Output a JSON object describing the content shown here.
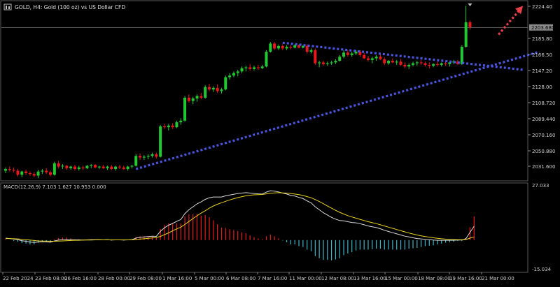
{
  "header": {
    "title": "GOLD, H4:  Gold (100 oz) vs US Dollar CFD",
    "icon": "chart-window-icon"
  },
  "colors": {
    "background": "#000000",
    "up": "#22c832",
    "down": "#e8191e",
    "grid": "#3c3c3c",
    "axis_text": "#d0d0d0",
    "trendline": "#4a55e0",
    "arrow": "#e8404a",
    "macd_pos": "#e8191e",
    "macd_neg": "#3fb6c6",
    "macd_line": "#d8d8d8",
    "signal_line": "#e6d21e",
    "price_line": "#8a8a8a"
  },
  "price_axis": {
    "labels": [
      "2224.40",
      "2185.80",
      "2166.50",
      "2147.20",
      "2128.00",
      "2108.720",
      "2089.440",
      "2070.160",
      "2050.880",
      "2031.600"
    ]
  },
  "current_price": "2203.680",
  "macd": {
    "label": "MACD(12,26,9) 7.103 1.627 10.953 0.000",
    "max_label": "27.033",
    "min_label": "-15.034"
  },
  "time_axis": {
    "labels": [
      "22 Feb 2024",
      "23 Feb 08:00",
      "26 Feb 16:00",
      "28 Feb 00:00",
      "29 Feb 08:00",
      "1 Mar 16:00",
      "5 Mar 00:00",
      "6 Mar 08:00",
      "7 Mar 16:00",
      "11 Mar 00:00",
      "12 Mar 08:00",
      "13 Mar 16:00",
      "15 Mar 00:00",
      "18 Mar 08:00",
      "19 Mar 16:00",
      "21 Mar 00:00"
    ]
  },
  "chart_data": {
    "type": "candlestick",
    "title": "GOLD, H4:  Gold (100 oz) vs US Dollar CFD",
    "ylim": [
      2020,
      2232
    ],
    "candles": [
      {
        "o": 2029,
        "h": 2033,
        "l": 2026,
        "c": 2031
      },
      {
        "o": 2031,
        "h": 2034,
        "l": 2028,
        "c": 2030
      },
      {
        "o": 2030,
        "h": 2033,
        "l": 2027,
        "c": 2029
      },
      {
        "o": 2029,
        "h": 2031,
        "l": 2022,
        "c": 2024
      },
      {
        "o": 2024,
        "h": 2029,
        "l": 2021,
        "c": 2028
      },
      {
        "o": 2028,
        "h": 2030,
        "l": 2024,
        "c": 2026
      },
      {
        "o": 2026,
        "h": 2028,
        "l": 2023,
        "c": 2025
      },
      {
        "o": 2025,
        "h": 2027,
        "l": 2021,
        "c": 2023
      },
      {
        "o": 2023,
        "h": 2030,
        "l": 2020,
        "c": 2028
      },
      {
        "o": 2028,
        "h": 2031,
        "l": 2025,
        "c": 2029
      },
      {
        "o": 2029,
        "h": 2032,
        "l": 2025,
        "c": 2027
      },
      {
        "o": 2027,
        "h": 2029,
        "l": 2022,
        "c": 2024
      },
      {
        "o": 2024,
        "h": 2040,
        "l": 2023,
        "c": 2038
      },
      {
        "o": 2038,
        "h": 2041,
        "l": 2032,
        "c": 2034
      },
      {
        "o": 2034,
        "h": 2037,
        "l": 2031,
        "c": 2035
      },
      {
        "o": 2035,
        "h": 2036,
        "l": 2030,
        "c": 2032
      },
      {
        "o": 2032,
        "h": 2035,
        "l": 2030,
        "c": 2034
      },
      {
        "o": 2034,
        "h": 2036,
        "l": 2029,
        "c": 2031
      },
      {
        "o": 2031,
        "h": 2035,
        "l": 2029,
        "c": 2033
      },
      {
        "o": 2033,
        "h": 2035,
        "l": 2030,
        "c": 2032
      },
      {
        "o": 2032,
        "h": 2036,
        "l": 2031,
        "c": 2035
      },
      {
        "o": 2035,
        "h": 2037,
        "l": 2032,
        "c": 2036
      },
      {
        "o": 2036,
        "h": 2037,
        "l": 2032,
        "c": 2033
      },
      {
        "o": 2033,
        "h": 2035,
        "l": 2031,
        "c": 2034
      },
      {
        "o": 2034,
        "h": 2036,
        "l": 2031,
        "c": 2032
      },
      {
        "o": 2032,
        "h": 2035,
        "l": 2030,
        "c": 2034
      },
      {
        "o": 2034,
        "h": 2036,
        "l": 2030,
        "c": 2031
      },
      {
        "o": 2031,
        "h": 2035,
        "l": 2029,
        "c": 2034
      },
      {
        "o": 2034,
        "h": 2036,
        "l": 2031,
        "c": 2033
      },
      {
        "o": 2033,
        "h": 2035,
        "l": 2030,
        "c": 2031
      },
      {
        "o": 2031,
        "h": 2035,
        "l": 2029,
        "c": 2034
      },
      {
        "o": 2034,
        "h": 2036,
        "l": 2032,
        "c": 2035
      },
      {
        "o": 2035,
        "h": 2049,
        "l": 2034,
        "c": 2047
      },
      {
        "o": 2047,
        "h": 2050,
        "l": 2042,
        "c": 2045
      },
      {
        "o": 2045,
        "h": 2048,
        "l": 2042,
        "c": 2046
      },
      {
        "o": 2046,
        "h": 2049,
        "l": 2043,
        "c": 2047
      },
      {
        "o": 2047,
        "h": 2051,
        "l": 2045,
        "c": 2049
      },
      {
        "o": 2049,
        "h": 2051,
        "l": 2044,
        "c": 2046
      },
      {
        "o": 2046,
        "h": 2085,
        "l": 2045,
        "c": 2083
      },
      {
        "o": 2083,
        "h": 2086,
        "l": 2080,
        "c": 2082
      },
      {
        "o": 2082,
        "h": 2086,
        "l": 2078,
        "c": 2084
      },
      {
        "o": 2084,
        "h": 2087,
        "l": 2080,
        "c": 2082
      },
      {
        "o": 2082,
        "h": 2090,
        "l": 2081,
        "c": 2088
      },
      {
        "o": 2088,
        "h": 2093,
        "l": 2085,
        "c": 2090
      },
      {
        "o": 2090,
        "h": 2120,
        "l": 2089,
        "c": 2118
      },
      {
        "o": 2118,
        "h": 2122,
        "l": 2112,
        "c": 2114
      },
      {
        "o": 2114,
        "h": 2119,
        "l": 2110,
        "c": 2117
      },
      {
        "o": 2117,
        "h": 2122,
        "l": 2113,
        "c": 2120
      },
      {
        "o": 2120,
        "h": 2124,
        "l": 2116,
        "c": 2118
      },
      {
        "o": 2118,
        "h": 2133,
        "l": 2117,
        "c": 2131
      },
      {
        "o": 2131,
        "h": 2135,
        "l": 2126,
        "c": 2128
      },
      {
        "o": 2128,
        "h": 2132,
        "l": 2125,
        "c": 2130
      },
      {
        "o": 2130,
        "h": 2134,
        "l": 2124,
        "c": 2126
      },
      {
        "o": 2126,
        "h": 2130,
        "l": 2123,
        "c": 2128
      },
      {
        "o": 2128,
        "h": 2145,
        "l": 2127,
        "c": 2143
      },
      {
        "o": 2143,
        "h": 2148,
        "l": 2140,
        "c": 2145
      },
      {
        "o": 2145,
        "h": 2150,
        "l": 2143,
        "c": 2148
      },
      {
        "o": 2148,
        "h": 2152,
        "l": 2144,
        "c": 2150
      },
      {
        "o": 2150,
        "h": 2156,
        "l": 2148,
        "c": 2154
      },
      {
        "o": 2154,
        "h": 2157,
        "l": 2150,
        "c": 2155
      },
      {
        "o": 2155,
        "h": 2159,
        "l": 2151,
        "c": 2153
      },
      {
        "o": 2153,
        "h": 2157,
        "l": 2151,
        "c": 2155
      },
      {
        "o": 2155,
        "h": 2158,
        "l": 2152,
        "c": 2154
      },
      {
        "o": 2154,
        "h": 2158,
        "l": 2153,
        "c": 2156
      },
      {
        "o": 2156,
        "h": 2176,
        "l": 2155,
        "c": 2174
      },
      {
        "o": 2174,
        "h": 2186,
        "l": 2173,
        "c": 2184
      },
      {
        "o": 2184,
        "h": 2186,
        "l": 2176,
        "c": 2178
      },
      {
        "o": 2178,
        "h": 2183,
        "l": 2176,
        "c": 2181
      },
      {
        "o": 2181,
        "h": 2183,
        "l": 2176,
        "c": 2178
      },
      {
        "o": 2178,
        "h": 2182,
        "l": 2176,
        "c": 2180
      },
      {
        "o": 2180,
        "h": 2182,
        "l": 2177,
        "c": 2179
      },
      {
        "o": 2179,
        "h": 2183,
        "l": 2178,
        "c": 2182
      },
      {
        "o": 2182,
        "h": 2183,
        "l": 2178,
        "c": 2179
      },
      {
        "o": 2179,
        "h": 2182,
        "l": 2178,
        "c": 2181
      },
      {
        "o": 2181,
        "h": 2183,
        "l": 2172,
        "c": 2174
      },
      {
        "o": 2174,
        "h": 2178,
        "l": 2172,
        "c": 2176
      },
      {
        "o": 2176,
        "h": 2178,
        "l": 2158,
        "c": 2160
      },
      {
        "o": 2160,
        "h": 2163,
        "l": 2155,
        "c": 2161
      },
      {
        "o": 2161,
        "h": 2163,
        "l": 2157,
        "c": 2159
      },
      {
        "o": 2159,
        "h": 2162,
        "l": 2157,
        "c": 2160
      },
      {
        "o": 2160,
        "h": 2163,
        "l": 2158,
        "c": 2161
      },
      {
        "o": 2161,
        "h": 2165,
        "l": 2159,
        "c": 2163
      },
      {
        "o": 2163,
        "h": 2170,
        "l": 2162,
        "c": 2168
      },
      {
        "o": 2168,
        "h": 2176,
        "l": 2166,
        "c": 2173
      },
      {
        "o": 2173,
        "h": 2176,
        "l": 2168,
        "c": 2170
      },
      {
        "o": 2170,
        "h": 2174,
        "l": 2168,
        "c": 2172
      },
      {
        "o": 2172,
        "h": 2176,
        "l": 2170,
        "c": 2174
      },
      {
        "o": 2174,
        "h": 2176,
        "l": 2168,
        "c": 2170
      },
      {
        "o": 2170,
        "h": 2173,
        "l": 2165,
        "c": 2166
      },
      {
        "o": 2166,
        "h": 2169,
        "l": 2162,
        "c": 2164
      },
      {
        "o": 2164,
        "h": 2168,
        "l": 2160,
        "c": 2166
      },
      {
        "o": 2166,
        "h": 2170,
        "l": 2163,
        "c": 2168
      },
      {
        "o": 2168,
        "h": 2171,
        "l": 2164,
        "c": 2165
      },
      {
        "o": 2165,
        "h": 2167,
        "l": 2158,
        "c": 2160
      },
      {
        "o": 2160,
        "h": 2164,
        "l": 2158,
        "c": 2163
      },
      {
        "o": 2163,
        "h": 2166,
        "l": 2160,
        "c": 2161
      },
      {
        "o": 2161,
        "h": 2164,
        "l": 2158,
        "c": 2162
      },
      {
        "o": 2162,
        "h": 2165,
        "l": 2157,
        "c": 2158
      },
      {
        "o": 2158,
        "h": 2161,
        "l": 2154,
        "c": 2156
      },
      {
        "o": 2156,
        "h": 2160,
        "l": 2153,
        "c": 2158
      },
      {
        "o": 2158,
        "h": 2162,
        "l": 2156,
        "c": 2160
      },
      {
        "o": 2160,
        "h": 2163,
        "l": 2157,
        "c": 2161
      },
      {
        "o": 2161,
        "h": 2164,
        "l": 2158,
        "c": 2160
      },
      {
        "o": 2160,
        "h": 2162,
        "l": 2156,
        "c": 2158
      },
      {
        "o": 2158,
        "h": 2161,
        "l": 2154,
        "c": 2157
      },
      {
        "o": 2157,
        "h": 2160,
        "l": 2155,
        "c": 2159
      },
      {
        "o": 2159,
        "h": 2162,
        "l": 2156,
        "c": 2158
      },
      {
        "o": 2158,
        "h": 2161,
        "l": 2156,
        "c": 2160
      },
      {
        "o": 2160,
        "h": 2162,
        "l": 2157,
        "c": 2159
      },
      {
        "o": 2159,
        "h": 2162,
        "l": 2156,
        "c": 2161
      },
      {
        "o": 2161,
        "h": 2164,
        "l": 2159,
        "c": 2162
      },
      {
        "o": 2162,
        "h": 2164,
        "l": 2158,
        "c": 2159
      },
      {
        "o": 2159,
        "h": 2182,
        "l": 2158,
        "c": 2180
      },
      {
        "o": 2180,
        "h": 2230,
        "l": 2179,
        "c": 2210
      },
      {
        "o": 2210,
        "h": 2212,
        "l": 2201,
        "c": 2204
      }
    ],
    "trendlines": [
      {
        "name": "resistance",
        "from": {
          "index": 68,
          "price": 2185
        },
        "to": {
          "index": 127,
          "price": 2152
        }
      },
      {
        "name": "support",
        "from": {
          "index": 32,
          "price": 2031
        },
        "to": {
          "index": 131,
          "price": 2174
        }
      }
    ],
    "arrow": {
      "from": {
        "index": 121,
        "price": 2195
      },
      "to": {
        "index": 127,
        "price": 2230
      }
    },
    "macd": {
      "ylim": [
        -15.034,
        27.033
      ],
      "macd": [
        1.0,
        0.8,
        0.5,
        0.2,
        -0.3,
        -0.6,
        -1.0,
        -1.2,
        -1.0,
        -0.8,
        -0.9,
        -1.1,
        -0.4,
        0.0,
        0.2,
        0.3,
        0.2,
        0.1,
        0.1,
        0.0,
        0.1,
        0.2,
        0.2,
        0.2,
        0.1,
        0.2,
        0.0,
        0.1,
        0.1,
        0.0,
        0.1,
        0.2,
        1.0,
        1.4,
        1.6,
        1.8,
        2.0,
        1.9,
        4.5,
        6.3,
        7.6,
        8.5,
        9.6,
        10.5,
        13.5,
        15.5,
        17.0,
        18.5,
        19.5,
        20.8,
        21.6,
        22.0,
        22.0,
        22.0,
        22.6,
        23.0,
        23.4,
        23.8,
        24.0,
        24.2,
        24.0,
        23.8,
        23.6,
        23.5,
        24.5,
        25.2,
        25.0,
        24.6,
        24.0,
        23.5,
        22.8,
        22.5,
        21.8,
        21.2,
        20.0,
        19.0,
        17.0,
        15.5,
        14.0,
        12.8,
        11.6,
        10.7,
        10.0,
        9.8,
        9.4,
        9.0,
        8.8,
        8.4,
        7.8,
        7.2,
        6.8,
        6.4,
        5.8,
        5.0,
        4.4,
        3.8,
        3.2,
        2.6,
        2.0,
        1.6,
        1.2,
        0.8,
        0.6,
        0.4,
        0.2,
        0.0,
        -0.1,
        -0.1,
        -0.1,
        -0.1,
        -0.1,
        0.0,
        0.0,
        0.8,
        4.0,
        7.1
      ],
      "signal": [
        0.8,
        0.8,
        0.7,
        0.6,
        0.4,
        0.2,
        0.0,
        -0.2,
        -0.4,
        -0.5,
        -0.5,
        -0.6,
        -0.6,
        -0.5,
        -0.4,
        -0.3,
        -0.2,
        -0.1,
        -0.1,
        0.0,
        0.0,
        0.0,
        0.1,
        0.1,
        0.1,
        0.1,
        0.1,
        0.1,
        0.1,
        0.1,
        0.1,
        0.1,
        0.3,
        0.5,
        0.7,
        0.9,
        1.1,
        1.3,
        1.9,
        2.8,
        3.7,
        4.7,
        5.7,
        6.6,
        8.0,
        9.5,
        11.0,
        12.4,
        13.8,
        15.0,
        16.3,
        17.4,
        18.3,
        19.1,
        19.8,
        20.5,
        21.1,
        21.7,
        22.2,
        22.6,
        22.9,
        23.1,
        23.2,
        23.3,
        23.6,
        23.9,
        24.1,
        24.2,
        24.1,
        24.0,
        23.8,
        23.5,
        23.2,
        22.8,
        22.2,
        21.6,
        20.7,
        19.7,
        18.6,
        17.4,
        16.3,
        15.2,
        14.2,
        13.3,
        12.5,
        11.8,
        11.2,
        10.6,
        10.0,
        9.4,
        8.9,
        8.4,
        7.8,
        7.2,
        6.6,
        6.0,
        5.4,
        4.8,
        4.2,
        3.6,
        3.1,
        2.6,
        2.2,
        1.8,
        1.5,
        1.2,
        0.9,
        0.7,
        0.5,
        0.4,
        0.3,
        0.2,
        0.2,
        0.3,
        1.0,
        1.6
      ],
      "histogram": [
        0.2,
        0.0,
        -0.2,
        -0.4,
        -0.7,
        -0.8,
        -1.0,
        -1.0,
        -0.6,
        -0.3,
        -0.4,
        -0.5,
        0.2,
        0.5,
        0.6,
        0.6,
        0.4,
        0.2,
        0.2,
        0.0,
        0.1,
        0.2,
        0.1,
        0.1,
        0.0,
        0.1,
        -0.1,
        0.0,
        0.0,
        -0.1,
        0.0,
        0.1,
        0.7,
        0.9,
        0.9,
        0.9,
        0.9,
        0.6,
        2.6,
        3.5,
        3.9,
        3.8,
        3.9,
        3.9,
        5.5,
        6.0,
        6.0,
        6.1,
        5.7,
        5.8,
        5.3,
        4.6,
        3.7,
        2.9,
        2.8,
        2.5,
        2.3,
        2.1,
        1.8,
        1.6,
        1.1,
        0.7,
        0.4,
        0.2,
        0.9,
        1.3,
        0.9,
        0.4,
        -0.1,
        -0.5,
        -1.0,
        -1.0,
        -1.4,
        -1.6,
        -2.2,
        -2.6,
        -3.7,
        -4.2,
        -4.6,
        -4.6,
        -4.7,
        -4.5,
        -4.2,
        -3.5,
        -3.1,
        -2.8,
        -2.4,
        -2.2,
        -2.2,
        -2.2,
        -2.1,
        -2.0,
        -2.0,
        -2.2,
        -2.2,
        -2.2,
        -2.2,
        -2.2,
        -2.2,
        -2.0,
        -1.9,
        -1.8,
        -1.6,
        -1.4,
        -1.3,
        -1.2,
        -1.0,
        -0.8,
        -0.6,
        -0.5,
        -0.4,
        -0.2,
        -0.2,
        0.5,
        3.0,
        5.5
      ]
    }
  }
}
